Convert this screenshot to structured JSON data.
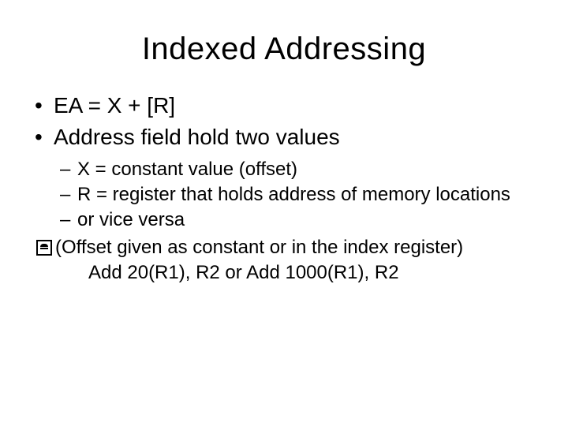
{
  "title": "Indexed  Addressing",
  "bullets": [
    "EA = X + [R]",
    "Address field hold two values"
  ],
  "subs": [
    "X = constant value (offset)",
    "R = register that holds address of memory locations",
    "or vice versa"
  ],
  "boxed": "(Offset given as constant or in the index register)",
  "example": "Add 20(R1), R2  or Add  1000(R1), R2"
}
